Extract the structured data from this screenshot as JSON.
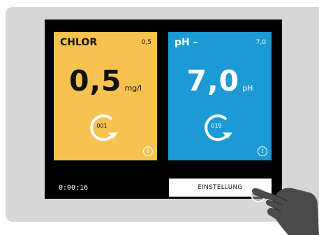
{
  "cards": [
    {
      "title": "CHLOR",
      "setpoint": "0,5",
      "value": "0,5",
      "unit": "mg/l",
      "dosing_count": "001",
      "color": "#f8c250",
      "icons": [
        "refresh-arrow-icon",
        "info-icon"
      ]
    },
    {
      "title": "pH –",
      "setpoint": "7,0",
      "value": "7,0",
      "unit": "pH",
      "dosing_count": "019",
      "color": "#1b9ad6",
      "icons": [
        "refresh-arrow-icon",
        "info-icon"
      ]
    }
  ],
  "footer": {
    "timer": "0:00:16",
    "settings_label": "EINSTELLUNG"
  },
  "info_symbol": "i"
}
